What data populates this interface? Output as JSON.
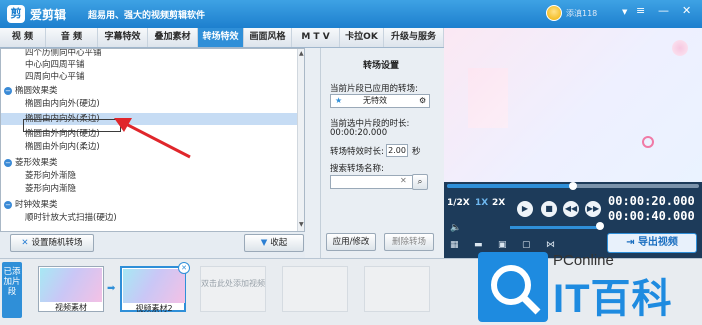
{
  "app": {
    "name": "爱剪辑",
    "slogan": "超易用、强大的视频剪辑软件",
    "username": "添滇118"
  },
  "tabs": [
    "视 频",
    "音 频",
    "字幕特效",
    "叠加素材",
    "转场特效",
    "画面风格",
    "M T V",
    "卡拉OK",
    "升级与服务"
  ],
  "effect_list": {
    "rows": [
      {
        "type": "item",
        "text": "四个历侧向中心平铺"
      },
      {
        "type": "item",
        "text": "中心向四周平铺"
      },
      {
        "type": "item",
        "text": "四周向中心平铺"
      },
      {
        "type": "group",
        "text": "椭圆效果类"
      },
      {
        "type": "item",
        "text": "椭圆由内向外(硬边)"
      },
      {
        "type": "item",
        "text": "椭圆由内向外(柔边)",
        "selected": true
      },
      {
        "type": "item",
        "text": "椭圆由外向内(硬边)"
      },
      {
        "type": "item",
        "text": "椭圆由外向内(柔边)"
      },
      {
        "type": "group",
        "text": "菱形效果类"
      },
      {
        "type": "item",
        "text": "菱形向外渐隐"
      },
      {
        "type": "item",
        "text": "菱形向内渐隐"
      },
      {
        "type": "group",
        "text": "时钟效果类"
      },
      {
        "type": "item",
        "text": "顺时针放大式扫描(硬边)"
      }
    ]
  },
  "bottom_buttons": {
    "random": "设置随机转场",
    "collapse": "收起"
  },
  "settings": {
    "title": "转场设置",
    "applied_label": "当前片段已应用的转场:",
    "applied_value": "无特效",
    "duration_label": "当前选中片段的时长:",
    "duration_value": "00:00:20.000",
    "effect_duration_label": "转场特效时长:",
    "effect_duration_value": "2.00",
    "effect_duration_unit": "秒",
    "search_label": "搜索转场名称:",
    "search_value": "",
    "apply_button": "应用/修改",
    "delete_button": "删除转场"
  },
  "player": {
    "speeds": [
      "1/2X",
      "1X",
      "2X"
    ],
    "current_time": "00:00:20.000",
    "total_time": "00:00:40.000",
    "seek_progress": 0.5,
    "export_label": "导出视频"
  },
  "timeline": {
    "side_label": "已添加片段",
    "clips": [
      {
        "caption": "视频素材"
      },
      {
        "caption": "视频素材2"
      }
    ],
    "empty_hint": "双击此处添加视频"
  },
  "watermark": {
    "line1": "PConline",
    "line2": "IT百科"
  },
  "colors": {
    "accent": "#2f8fd8",
    "title_bar": "#1d7fce",
    "annotation_arrow": "#e0262b"
  }
}
